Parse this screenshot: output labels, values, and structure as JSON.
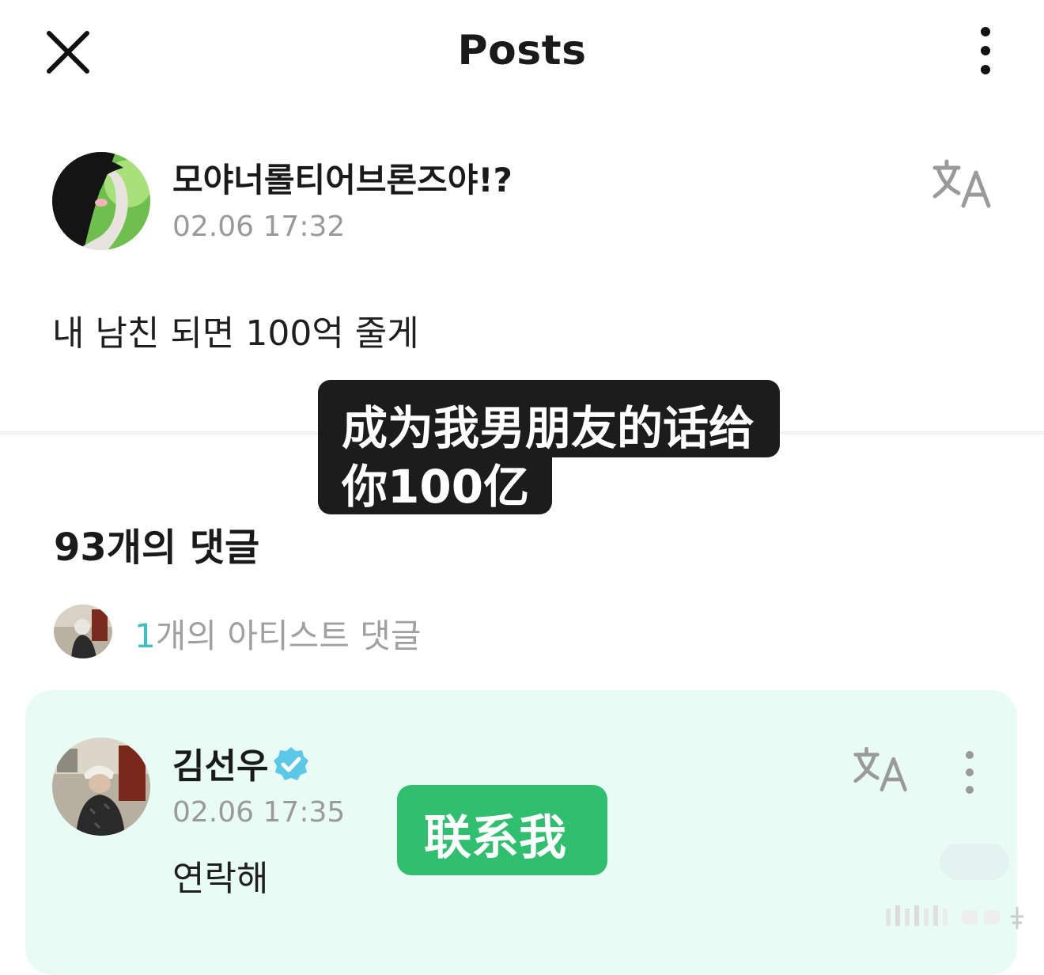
{
  "header": {
    "title": "Posts"
  },
  "post": {
    "author": "모야너롤티어브론즈야!?",
    "time": "02.06 17:32",
    "body": "내 남친 되면 100억 줄게"
  },
  "subtitle_1": {
    "line1": "成为我男朋友的话给",
    "line2": "你100亿"
  },
  "comments": {
    "count_label": "93개의 댓글",
    "artist_count": "1",
    "artist_label": "개의 아티스트 댓글"
  },
  "artist_comment": {
    "name": "김선우",
    "time": "02.06 17:35",
    "body": "연락해"
  },
  "subtitle_2": {
    "text": "联系我"
  },
  "colors": {
    "accent_teal": "#3cc0c0",
    "card_bg": "#e8fbf5",
    "verified_badge": "#5cc8e8",
    "subtitle_green": "#2fbf6e",
    "subtitle_dark": "#1c1c1c"
  },
  "icons": [
    "close-icon",
    "more-vertical-icon",
    "translate-icon",
    "verified-badge-icon"
  ]
}
